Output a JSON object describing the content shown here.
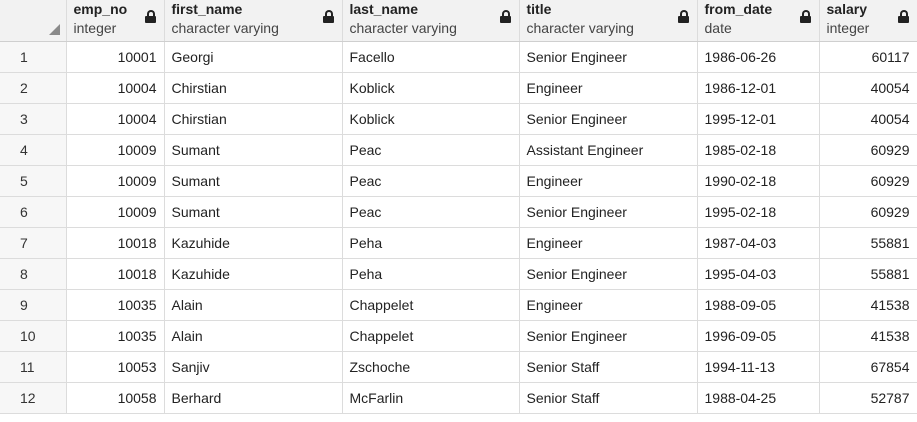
{
  "columns": [
    {
      "name": "emp_no",
      "type": "integer"
    },
    {
      "name": "first_name",
      "type": "character varying"
    },
    {
      "name": "last_name",
      "type": "character varying"
    },
    {
      "name": "title",
      "type": "character varying"
    },
    {
      "name": "from_date",
      "type": "date"
    },
    {
      "name": "salary",
      "type": "integer"
    }
  ],
  "rows": [
    {
      "idx": "1",
      "emp_no": "10001",
      "first_name": "Georgi",
      "last_name": "Facello",
      "title": "Senior Engineer",
      "from_date": "1986-06-26",
      "salary": "60117"
    },
    {
      "idx": "2",
      "emp_no": "10004",
      "first_name": "Chirstian",
      "last_name": "Koblick",
      "title": "Engineer",
      "from_date": "1986-12-01",
      "salary": "40054"
    },
    {
      "idx": "3",
      "emp_no": "10004",
      "first_name": "Chirstian",
      "last_name": "Koblick",
      "title": "Senior Engineer",
      "from_date": "1995-12-01",
      "salary": "40054"
    },
    {
      "idx": "4",
      "emp_no": "10009",
      "first_name": "Sumant",
      "last_name": "Peac",
      "title": "Assistant Engineer",
      "from_date": "1985-02-18",
      "salary": "60929"
    },
    {
      "idx": "5",
      "emp_no": "10009",
      "first_name": "Sumant",
      "last_name": "Peac",
      "title": "Engineer",
      "from_date": "1990-02-18",
      "salary": "60929"
    },
    {
      "idx": "6",
      "emp_no": "10009",
      "first_name": "Sumant",
      "last_name": "Peac",
      "title": "Senior Engineer",
      "from_date": "1995-02-18",
      "salary": "60929"
    },
    {
      "idx": "7",
      "emp_no": "10018",
      "first_name": "Kazuhide",
      "last_name": "Peha",
      "title": "Engineer",
      "from_date": "1987-04-03",
      "salary": "55881"
    },
    {
      "idx": "8",
      "emp_no": "10018",
      "first_name": "Kazuhide",
      "last_name": "Peha",
      "title": "Senior Engineer",
      "from_date": "1995-04-03",
      "salary": "55881"
    },
    {
      "idx": "9",
      "emp_no": "10035",
      "first_name": "Alain",
      "last_name": "Chappelet",
      "title": "Engineer",
      "from_date": "1988-09-05",
      "salary": "41538"
    },
    {
      "idx": "10",
      "emp_no": "10035",
      "first_name": "Alain",
      "last_name": "Chappelet",
      "title": "Senior Engineer",
      "from_date": "1996-09-05",
      "salary": "41538"
    },
    {
      "idx": "11",
      "emp_no": "10053",
      "first_name": "Sanjiv",
      "last_name": "Zschoche",
      "title": "Senior Staff",
      "from_date": "1994-11-13",
      "salary": "67854"
    },
    {
      "idx": "12",
      "emp_no": "10058",
      "first_name": "Berhard",
      "last_name": "McFarlin",
      "title": "Senior Staff",
      "from_date": "1988-04-25",
      "salary": "52787"
    }
  ],
  "icons": {
    "column_lock": "lock-icon",
    "select_all": "select-all-corner-icon"
  }
}
